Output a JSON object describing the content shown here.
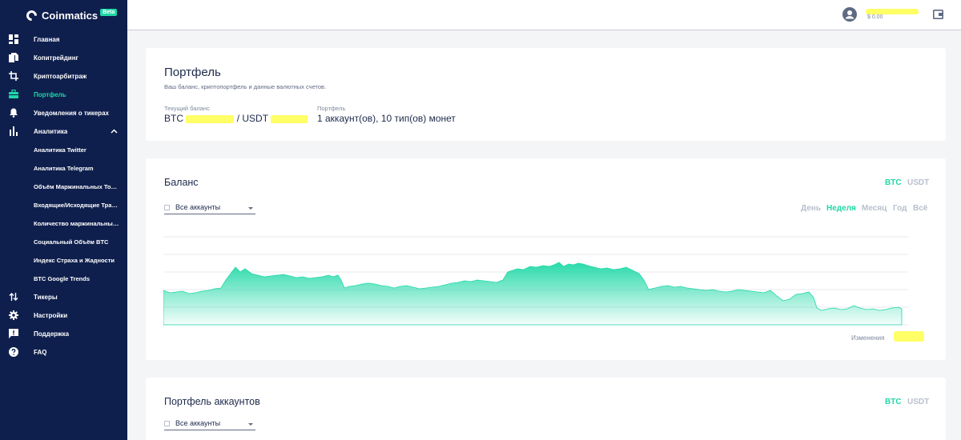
{
  "app": {
    "name": "Coinmatics",
    "badge": "Beta"
  },
  "colors": {
    "sidebar": "#0f1f4d",
    "accent": "#1ed8a6",
    "highlight": "#ffff66"
  },
  "sidebar": {
    "items": [
      {
        "label": "Главная",
        "icon": "dashboard-icon"
      },
      {
        "label": "Копитрейдинг",
        "icon": "copy-icon"
      },
      {
        "label": "Криптоарбитраж",
        "icon": "crop-icon"
      },
      {
        "label": "Портфель",
        "icon": "briefcase-icon",
        "active": true
      },
      {
        "label": "Уведомления о тикерах",
        "icon": "bell-icon"
      },
      {
        "label": "Аналитика",
        "icon": "bar-chart-icon",
        "expanded": true
      }
    ],
    "analytics_sub": [
      "Аналитика Twitter",
      "Аналитика Telegram",
      "Объём Маржинальных Торгов",
      "Входящие/Исходящие Транз...",
      "Количество маржинальных ...",
      "Социальный Объём BTC",
      "Индекс Страха и Жадности",
      "BTC Google Trends"
    ],
    "bottom_items": [
      {
        "label": "Тикеры",
        "icon": "swap-vertical-icon"
      },
      {
        "label": "Настройки",
        "icon": "gear-icon"
      },
      {
        "label": "Поддержка",
        "icon": "chat-icon"
      },
      {
        "label": "FAQ",
        "icon": "help-icon"
      }
    ]
  },
  "topbar": {
    "balance": "$ 0.00"
  },
  "portfolio": {
    "title": "Портфель",
    "description": "Ваш баланс, криптопортфель и данные валютных счетов.",
    "current_balance_label": "Текущий баланс",
    "balance_btc_prefix": "BTC",
    "balance_separator": "/ USDT",
    "portfolio_label": "Портфель",
    "portfolio_value": "1 аккаунт(ов), 10 тип(ов) монет"
  },
  "balance": {
    "title": "Баланс",
    "currency_on": "BTC",
    "currency_off": "USDT",
    "select_value": "Все аккаунты",
    "periods": [
      "День",
      "Неделя",
      "Месяц",
      "Год",
      "Всё"
    ],
    "active_period": "Неделя",
    "changes_label": "Изменения"
  },
  "accounts_portfolio": {
    "title": "Портфель аккаунтов",
    "currency_on": "BTC",
    "currency_off": "USDT",
    "select_value": "Все аккаунты"
  }
}
